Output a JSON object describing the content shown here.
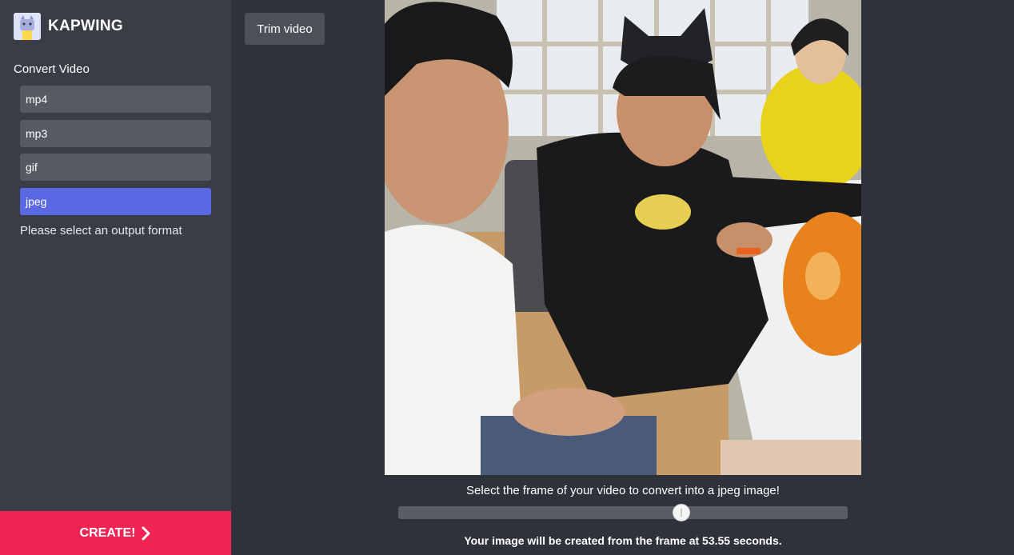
{
  "brand": {
    "name": "KAPWING",
    "logo_icon": "kapwing-cat-logo-icon"
  },
  "sidebar": {
    "section_title": "Convert Video",
    "formats": [
      {
        "label": "mp4",
        "selected": false
      },
      {
        "label": "mp3",
        "selected": false
      },
      {
        "label": "gif",
        "selected": false
      },
      {
        "label": "jpeg",
        "selected": true
      }
    ],
    "hint": "Please select an output format",
    "create_label": "CREATE!",
    "create_icon": "chevron-right-icon"
  },
  "toolbar": {
    "trim_label": "Trim video"
  },
  "main": {
    "caption": "Select the frame of your video to convert into a jpeg image!",
    "slider_position": 0.63,
    "footnote": "Your image will be created from the frame at 53.55 seconds."
  },
  "colors": {
    "accent": "#5b68e3",
    "create": "#ef2453",
    "sidebar": "#3a3d46",
    "background": "#2f323b"
  }
}
